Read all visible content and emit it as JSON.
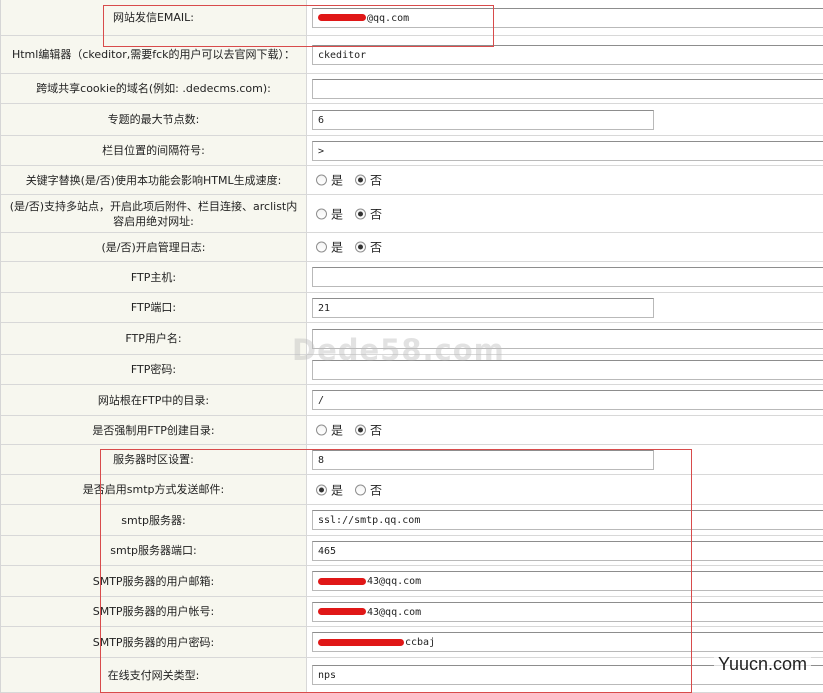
{
  "rows": [
    {
      "label": "网站发信EMAIL:",
      "type": "text",
      "value": "@qq.com",
      "redact_prefix": true
    },
    {
      "label": "Html编辑器（ckeditor,需要fck的用户可以去官网下载）：",
      "type": "text",
      "value": "ckeditor"
    },
    {
      "label": "跨域共享cookie的域名(例如: .dedecms.com):",
      "type": "text",
      "value": ""
    },
    {
      "label": "专题的最大节点数:",
      "type": "text",
      "value": "6",
      "short": true
    },
    {
      "label": "栏目位置的间隔符号:",
      "type": "text",
      "value": " > "
    },
    {
      "label": "关键字替换(是/否)使用本功能会影响HTML生成速度:",
      "type": "radio",
      "options": [
        "是",
        "否"
      ],
      "selected": 1
    },
    {
      "label": "(是/否)支持多站点，开启此项后附件、栏目连接、arclist内容启用绝对网址:",
      "type": "radio",
      "options": [
        "是",
        "否"
      ],
      "selected": 1
    },
    {
      "label": "(是/否)开启管理日志:",
      "type": "radio",
      "options": [
        "是",
        "否"
      ],
      "selected": 1
    },
    {
      "label": "FTP主机:",
      "type": "text",
      "value": ""
    },
    {
      "label": "FTP端口:",
      "type": "text",
      "value": "21",
      "short": true
    },
    {
      "label": "FTP用户名:",
      "type": "text",
      "value": ""
    },
    {
      "label": "FTP密码:",
      "type": "text",
      "value": ""
    },
    {
      "label": "网站根在FTP中的目录:",
      "type": "text",
      "value": "/"
    },
    {
      "label": "是否强制用FTP创建目录:",
      "type": "radio",
      "options": [
        "是",
        "否"
      ],
      "selected": 1
    },
    {
      "label": "服务器时区设置:",
      "type": "text",
      "value": "8",
      "short": true
    },
    {
      "label": "是否启用smtp方式发送邮件:",
      "type": "radio",
      "options": [
        "是",
        "否"
      ],
      "selected": 0
    },
    {
      "label": "smtp服务器:",
      "type": "text",
      "value": "ssl://smtp.qq.com"
    },
    {
      "label": "smtp服务器端口:",
      "type": "text",
      "value": "465"
    },
    {
      "label": "SMTP服务器的用户邮箱:",
      "type": "text",
      "value": "43@qq.com",
      "redact_prefix": true
    },
    {
      "label": "SMTP服务器的用户帐号:",
      "type": "text",
      "value": "43@qq.com",
      "redact_prefix": true
    },
    {
      "label": "SMTP服务器的用户密码:",
      "type": "text",
      "value": "ccbaj",
      "redact_prefix": true
    },
    {
      "label": "在线支付网关类型:",
      "type": "text",
      "value": "nps"
    }
  ],
  "watermark": "Dede58.com",
  "site_mark": "Yuucn.com",
  "colors": {
    "label_bg": "#f7f7ef",
    "highlight": "#d84b4b",
    "redaction": "#e01717"
  }
}
